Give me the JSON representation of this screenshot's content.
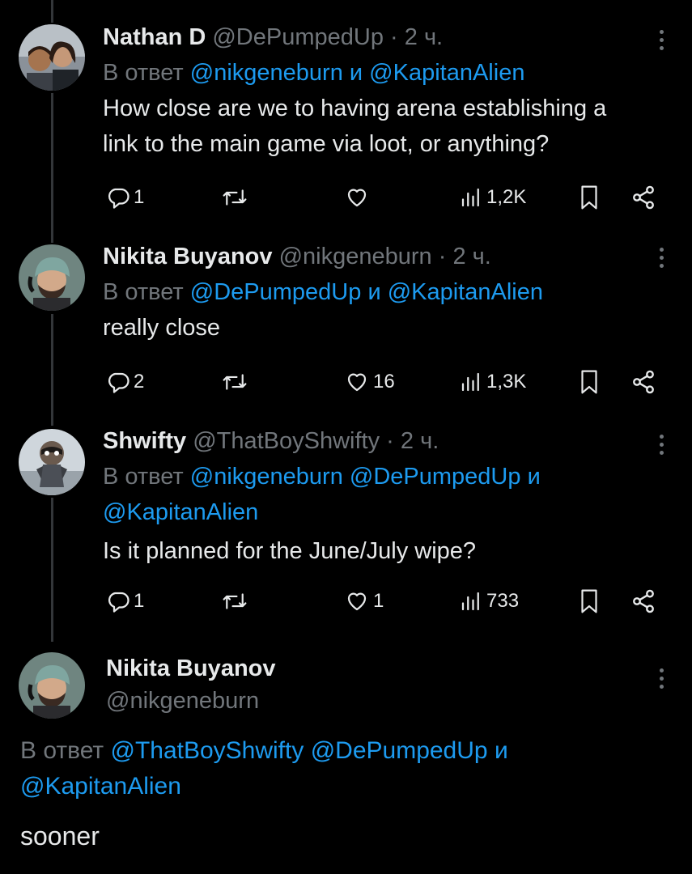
{
  "tweets": [
    {
      "name": "Nathan D",
      "handle": "@DePumpedUp",
      "separator": "·",
      "time": "2 ч.",
      "reply_prefix": "В ответ",
      "reply_mentions": [
        "@nikgeneburn",
        "@KapitanAlien"
      ],
      "reply_conjunction": "и",
      "text_lines": [
        "How close are we to having arena establishing a",
        "link to the main game via loot, or anything?"
      ],
      "replies": "1",
      "retweets": "",
      "likes": "",
      "views": "1,2K"
    },
    {
      "name": "Nikita Buyanov",
      "handle": "@nikgeneburn",
      "separator": "·",
      "time": "2 ч.",
      "reply_prefix": "В ответ",
      "reply_mentions": [
        "@DePumpedUp",
        "@KapitanAlien"
      ],
      "reply_conjunction": "и",
      "text_lines": [
        "really close"
      ],
      "replies": "2",
      "retweets": "",
      "likes": "16",
      "views": "1,3K"
    },
    {
      "name": "Shwifty",
      "handle": "@ThatBoyShwifty",
      "separator": "·",
      "time": "2 ч.",
      "reply_prefix": "В ответ",
      "reply_mentions": [
        "@nikgeneburn",
        "@DePumpedUp",
        "@KapitanAlien"
      ],
      "reply_conjunction": "и",
      "text_lines": [
        "Is it planned for the June/July wipe?"
      ],
      "replies": "1",
      "retweets": "",
      "likes": "1",
      "views": "733"
    }
  ],
  "main_tweet": {
    "name": "Nikita Buyanov",
    "handle": "@nikgeneburn",
    "reply_prefix": "В ответ",
    "reply_mentions": [
      "@ThatBoyShwifty",
      "@DePumpedUp",
      "@KapitanAlien"
    ],
    "reply_conjunction": "и",
    "text": "sooner"
  },
  "icons": {
    "reply": "reply-icon",
    "retweet": "retweet-icon",
    "like": "heart-icon",
    "views": "views-icon",
    "bookmark": "bookmark-icon",
    "share": "share-icon",
    "more": "more-icon"
  },
  "colors": {
    "background": "#000000",
    "text": "#e7e9ea",
    "muted": "#71767b",
    "link": "#1d9bf0",
    "thread_line": "#333639"
  }
}
